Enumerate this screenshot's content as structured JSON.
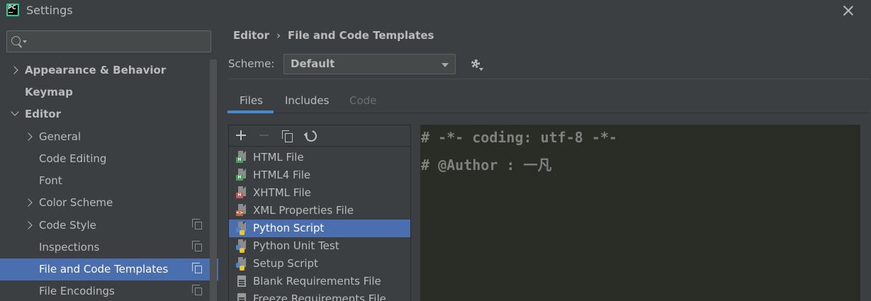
{
  "window": {
    "title": "Settings",
    "logo_text": "PC"
  },
  "sidebar": {
    "search": {
      "value": "",
      "placeholder": ""
    },
    "items": [
      {
        "label": "Appearance & Behavior",
        "bold": true,
        "expander": "collapsed"
      },
      {
        "label": "Keymap",
        "bold": true,
        "expander": "none"
      },
      {
        "label": "Editor",
        "bold": true,
        "expander": "expanded"
      },
      {
        "label": "General",
        "bold": false,
        "expander": "collapsed"
      },
      {
        "label": "Code Editing",
        "bold": false,
        "expander": "none"
      },
      {
        "label": "Font",
        "bold": false,
        "expander": "none"
      },
      {
        "label": "Color Scheme",
        "bold": false,
        "expander": "collapsed"
      },
      {
        "label": "Code Style",
        "bold": false,
        "expander": "collapsed",
        "project_icon": true
      },
      {
        "label": "Inspections",
        "bold": false,
        "expander": "none",
        "project_icon": true
      },
      {
        "label": "File and Code Templates",
        "bold": false,
        "expander": "none",
        "project_icon": true,
        "selected": true
      },
      {
        "label": "File Encodings",
        "bold": false,
        "expander": "none",
        "project_icon": true
      }
    ]
  },
  "breadcrumb": {
    "parent": "Editor",
    "separator": "›",
    "current": "File and Code Templates"
  },
  "scheme": {
    "label": "Scheme:",
    "value": "Default"
  },
  "tabs": [
    {
      "label": "Files",
      "active": true
    },
    {
      "label": "Includes",
      "active": false
    },
    {
      "label": "Code",
      "active": false,
      "disabled": true
    }
  ],
  "templates": {
    "toolbar": [
      "add-icon",
      "remove-icon",
      "copy-icon",
      "reset-icon"
    ],
    "items": [
      {
        "label": "HTML File",
        "icon": "html-file-icon",
        "tag": "H"
      },
      {
        "label": "HTML4 File",
        "icon": "html-file-icon",
        "tag": "H"
      },
      {
        "label": "XHTML File",
        "icon": "xhtml-file-icon",
        "tag": "H"
      },
      {
        "label": "XML Properties File",
        "icon": "xml-file-icon",
        "tag": "<>"
      },
      {
        "label": "Python Script",
        "icon": "python-file-icon",
        "selected": true
      },
      {
        "label": "Python Unit Test",
        "icon": "python-file-icon"
      },
      {
        "label": "Setup Script",
        "icon": "python-file-icon"
      },
      {
        "label": "Blank Requirements File",
        "icon": "text-file-icon"
      },
      {
        "label": "Freeze Requirements File",
        "icon": "text-file-icon"
      }
    ]
  },
  "editor": {
    "lines": [
      "# -*- coding: utf-8 -*-",
      "# @Author : 一凡"
    ]
  },
  "colors": {
    "background": "#3c3f41",
    "selection": "#4b6eaf",
    "tab_underline": "#4a88c7",
    "editor_background": "#2a2c26",
    "comment": "#808080"
  }
}
